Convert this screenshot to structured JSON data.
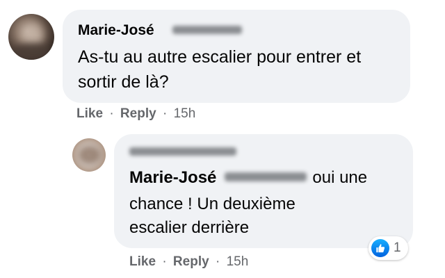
{
  "comment": {
    "author": "Marie-José",
    "text": "As-tu au autre escalier pour entrer et sortir de là?",
    "actions": {
      "like": "Like",
      "reply": "Reply",
      "separator": "·",
      "time": "15h"
    }
  },
  "reply": {
    "mention": "Marie-José",
    "line1_tail": "oui une",
    "line2": "chance ! Un deuxième",
    "line3": "escalier derrière",
    "reaction": {
      "icon": "thumbs-up-icon",
      "count": "1",
      "color": "#1877f2"
    },
    "actions": {
      "like": "Like",
      "reply": "Reply",
      "separator": "·",
      "time": "15h"
    }
  },
  "colors": {
    "bubble": "#f0f2f5",
    "meta_text": "#65676b",
    "text": "#050505"
  }
}
